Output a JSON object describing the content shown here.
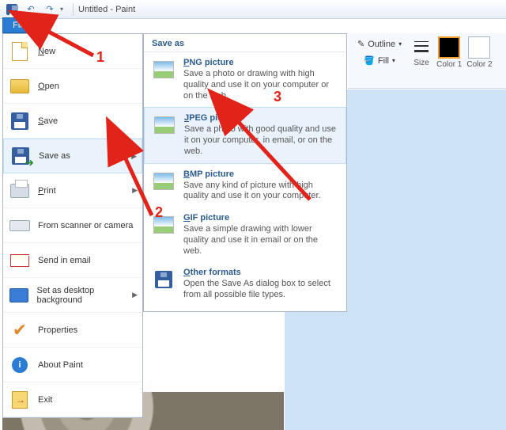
{
  "titlebar": {
    "title": "Untitled - Paint"
  },
  "file_tab": {
    "label": "File"
  },
  "ribbon": {
    "outline": "Outline",
    "fill": "Fill",
    "size": "Size",
    "color1": "Color 1",
    "color2": "Color 2",
    "color1_swatch": "#000000",
    "color2_swatch": "#ffffff"
  },
  "file_menu": {
    "items": [
      {
        "label": "New"
      },
      {
        "label": "Open"
      },
      {
        "label": "Save"
      },
      {
        "label": "Save as"
      },
      {
        "label": "Print"
      },
      {
        "label": "From scanner or camera"
      },
      {
        "label": "Send in email"
      },
      {
        "label": "Set as desktop background"
      },
      {
        "label": "Properties"
      },
      {
        "label": "About Paint"
      },
      {
        "label": "Exit"
      }
    ]
  },
  "save_as_submenu": {
    "header": "Save as",
    "items": [
      {
        "title": "PNG picture",
        "desc": "Save a photo or drawing with high quality and use it on your computer or on the web."
      },
      {
        "title": "JPEG picture",
        "desc": "Save a photo with good quality and use it on your computer, in email, or on the web."
      },
      {
        "title": "BMP picture",
        "desc": "Save any kind of picture with high quality and use it on your computer."
      },
      {
        "title": "GIF picture",
        "desc": "Save a simple drawing with lower quality and use it in email or on the web."
      },
      {
        "title": "Other formats",
        "desc": "Open the Save As dialog box to select from all possible file types."
      }
    ]
  },
  "annotations": {
    "n1": "1",
    "n2": "2",
    "n3": "3"
  }
}
